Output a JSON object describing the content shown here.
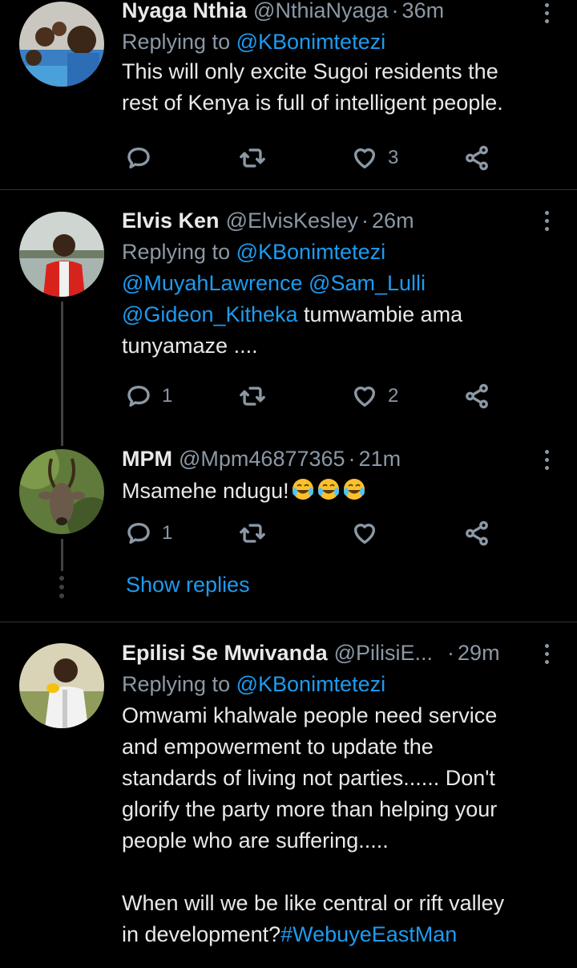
{
  "tweets": [
    {
      "name": "Nyaga Nthia",
      "handle": "@NthiaNyaga",
      "dot": "·",
      "time": "36m",
      "replying_prefix": "Replying to",
      "replying_to": "@KBonimtetezi",
      "text_lines": [
        "This will only excite Sugoi residents the",
        "rest of Kenya is full of intelligent people."
      ],
      "reply_count": "",
      "retweet_count": "",
      "like_count": "3"
    },
    {
      "name": "Elvis Ken",
      "handle": "@ElvisKesley",
      "dot": "·",
      "time": "26m",
      "replying_prefix": "Replying to",
      "replying_to": "@KBonimtetezi",
      "mentions": [
        "@MuyahLawrence",
        "@Sam_Lulli",
        "@Gideon_Kitheka"
      ],
      "text_after_mentions": " tumwambie ama",
      "text_last_line": "tunyamaze ....",
      "reply_count": "1",
      "retweet_count": "",
      "like_count": "2"
    },
    {
      "name": "MPM",
      "handle": "@Mpm46877365",
      "dot": "·",
      "time": "21m",
      "text": "Msamehe ndugu!",
      "emoji": "face-with-tears-of-joy",
      "reply_count": "1",
      "retweet_count": "",
      "like_count": ""
    },
    {
      "name": "Epilisi Se Mwivanda",
      "handle": "@PilisiE...",
      "dot": "·",
      "time": "29m",
      "replying_prefix": "Replying to",
      "replying_to": "@KBonimtetezi",
      "text_lines": [
        "Omwami khalwale people need service",
        "and empowerment to update the",
        "standards of living not parties...... Don't",
        "glorify the party more than helping your",
        "people who are suffering....."
      ],
      "text_lines_2": [
        "When will we be like central or rift valley"
      ],
      "text_last_prefix": "in development?",
      "hashtag": "#WebuyeEastMan"
    }
  ],
  "show_replies": "Show replies",
  "colors": {
    "background": "#000000",
    "accent": "#1d9bf0",
    "secondary": "#8b98a5",
    "divider": "#2f3336"
  }
}
